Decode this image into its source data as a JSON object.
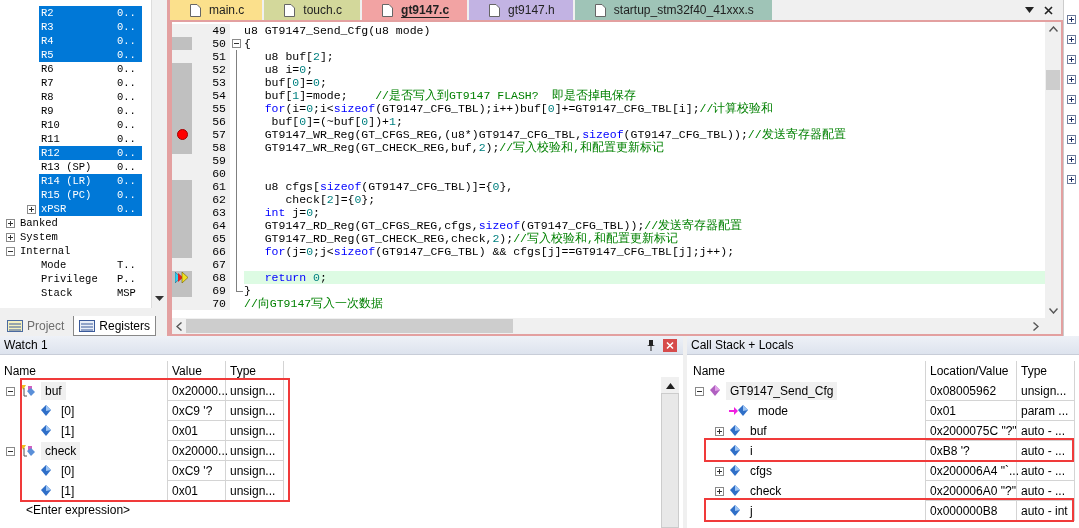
{
  "registers": {
    "rows": [
      {
        "name": "R2",
        "value": "0..",
        "selected": true
      },
      {
        "name": "R3",
        "value": "0..",
        "selected": true
      },
      {
        "name": "R4",
        "value": "0..",
        "selected": true
      },
      {
        "name": "R5",
        "value": "0..",
        "selected": true
      },
      {
        "name": "R6",
        "value": "0..",
        "selected": false
      },
      {
        "name": "R7",
        "value": "0..",
        "selected": false
      },
      {
        "name": "R8",
        "value": "0..",
        "selected": false
      },
      {
        "name": "R9",
        "value": "0..",
        "selected": false
      },
      {
        "name": "R10",
        "value": "0..",
        "selected": false
      },
      {
        "name": "R11",
        "value": "0..",
        "selected": false
      },
      {
        "name": "R12",
        "value": "0..",
        "selected": true
      },
      {
        "name": "R13 (SP)",
        "value": "0..",
        "selected": false
      },
      {
        "name": "R14 (LR)",
        "value": "0..",
        "selected": true
      },
      {
        "name": "R15 (PC)",
        "value": "0..",
        "selected": true
      },
      {
        "name": "xPSR",
        "value": "0..",
        "selected": true,
        "expanded": false
      }
    ],
    "groups": [
      {
        "name": "Banked",
        "selected": false,
        "expanded": false
      },
      {
        "name": "System",
        "selected": false,
        "expanded": false
      },
      {
        "name": "Internal",
        "selected": false,
        "expanded": true,
        "children": [
          {
            "name": "Mode",
            "value": "T..",
            "selected": false
          },
          {
            "name": "Privilege",
            "value": "P..",
            "selected": false
          },
          {
            "name": "Stack",
            "value": "MSP",
            "selected": false
          }
        ]
      }
    ]
  },
  "panel_tabs": [
    {
      "label": "Project",
      "selected": false
    },
    {
      "label": "Registers",
      "selected": true
    }
  ],
  "editor": {
    "tabs": [
      {
        "label": "main.c",
        "selected": false,
        "color": "#fbe08c"
      },
      {
        "label": "touch.c",
        "selected": false,
        "color": "#d3d89b"
      },
      {
        "label": "gt9147.c",
        "selected": true,
        "color": "#f2a3a3"
      },
      {
        "label": "gt9147.h",
        "selected": false,
        "color": "#c2b3e3"
      },
      {
        "label": "startup_stm32f40_41xxx.s",
        "selected": false,
        "color": "#9fc4b7"
      }
    ],
    "lines": [
      {
        "number": "49",
        "executable": false,
        "segments": [
          {
            "text": "u8 GT9147_Send_Cfg(u8 mode)",
            "kind": "plain"
          }
        ]
      },
      {
        "number": "50",
        "executable": true,
        "expanded": true,
        "segments": [
          {
            "text": "{",
            "kind": "plain"
          }
        ]
      },
      {
        "number": "51",
        "executable": false,
        "in_block": true,
        "segments": [
          {
            "text": "u8 buf[",
            "kind": "plain"
          },
          {
            "text": "2",
            "kind": "number"
          },
          {
            "text": "];",
            "kind": "plain"
          }
        ]
      },
      {
        "number": "52",
        "executable": true,
        "in_block": true,
        "segments": [
          {
            "text": "u8 i=",
            "kind": "plain"
          },
          {
            "text": "0",
            "kind": "number"
          },
          {
            "text": ";",
            "kind": "plain"
          }
        ]
      },
      {
        "number": "53",
        "executable": true,
        "in_block": true,
        "segments": [
          {
            "text": "buf[",
            "kind": "plain"
          },
          {
            "text": "0",
            "kind": "number"
          },
          {
            "text": "]=",
            "kind": "plain"
          },
          {
            "text": "0",
            "kind": "number"
          },
          {
            "text": ";",
            "kind": "plain"
          }
        ]
      },
      {
        "number": "54",
        "executable": true,
        "in_block": true,
        "segments": [
          {
            "text": "buf[",
            "kind": "plain"
          },
          {
            "text": "1",
            "kind": "number"
          },
          {
            "text": "]=mode;    ",
            "kind": "plain"
          },
          {
            "text": "//是否写入到GT9147 FLASH?  即是否掉电保存",
            "kind": "comment"
          }
        ]
      },
      {
        "number": "55",
        "executable": true,
        "in_block": true,
        "segments": [
          {
            "text": "for",
            "kind": "keyword"
          },
          {
            "text": "(i=",
            "kind": "plain"
          },
          {
            "text": "0",
            "kind": "number"
          },
          {
            "text": ";i<",
            "kind": "plain"
          },
          {
            "text": "sizeof",
            "kind": "keyword"
          },
          {
            "text": "(GT9147_CFG_TBL);i++)buf[",
            "kind": "plain"
          },
          {
            "text": "0",
            "kind": "number"
          },
          {
            "text": "]+=GT9147_CFG_TBL[i];",
            "kind": "plain"
          },
          {
            "text": "//计算校验和",
            "kind": "comment"
          }
        ]
      },
      {
        "number": "56",
        "executable": true,
        "in_block": true,
        "segments": [
          {
            "text": " buf[",
            "kind": "plain"
          },
          {
            "text": "0",
            "kind": "number"
          },
          {
            "text": "]=(~buf[",
            "kind": "plain"
          },
          {
            "text": "0",
            "kind": "number"
          },
          {
            "text": "])+",
            "kind": "plain"
          },
          {
            "text": "1",
            "kind": "number"
          },
          {
            "text": ";",
            "kind": "plain"
          }
        ]
      },
      {
        "number": "57",
        "executable": true,
        "in_block": true,
        "breakpoint": true,
        "segments": [
          {
            "text": "GT9147_WR_Reg(GT_CFGS_REG,(u8*)GT9147_CFG_TBL,",
            "kind": "plain"
          },
          {
            "text": "sizeof",
            "kind": "keyword"
          },
          {
            "text": "(GT9147_CFG_TBL));",
            "kind": "plain"
          },
          {
            "text": "//发送寄存器配置",
            "kind": "comment"
          }
        ]
      },
      {
        "number": "58",
        "executable": true,
        "in_block": true,
        "segments": [
          {
            "text": "GT9147_WR_Reg(GT_CHECK_REG,buf,",
            "kind": "plain"
          },
          {
            "text": "2",
            "kind": "number"
          },
          {
            "text": ");",
            "kind": "plain"
          },
          {
            "text": "//写入校验和,和配置更新标记",
            "kind": "comment"
          }
        ]
      },
      {
        "number": "59",
        "executable": false,
        "in_block": true
      },
      {
        "number": "60",
        "executable": false,
        "in_block": true
      },
      {
        "number": "61",
        "executable": true,
        "in_block": true,
        "segments": [
          {
            "text": "u8 cfgs[",
            "kind": "plain"
          },
          {
            "text": "sizeof",
            "kind": "keyword"
          },
          {
            "text": "(GT9147_CFG_TBL)]={",
            "kind": "plain"
          },
          {
            "text": "0",
            "kind": "number"
          },
          {
            "text": "},",
            "kind": "plain"
          }
        ]
      },
      {
        "number": "62",
        "executable": true,
        "in_block": true,
        "segments": [
          {
            "text": "   check[",
            "kind": "plain"
          },
          {
            "text": "2",
            "kind": "number"
          },
          {
            "text": "]={",
            "kind": "plain"
          },
          {
            "text": "0",
            "kind": "number"
          },
          {
            "text": "};",
            "kind": "plain"
          }
        ]
      },
      {
        "number": "63",
        "executable": true,
        "in_block": true,
        "segments": [
          {
            "text": "int",
            "kind": "keyword"
          },
          {
            "text": " j=",
            "kind": "plain"
          },
          {
            "text": "0",
            "kind": "number"
          },
          {
            "text": ";",
            "kind": "plain"
          }
        ]
      },
      {
        "number": "64",
        "executable": true,
        "in_block": true,
        "segments": [
          {
            "text": "GT9147_RD_Reg(GT_CFGS_REG,cfgs,",
            "kind": "plain"
          },
          {
            "text": "sizeof",
            "kind": "keyword"
          },
          {
            "text": "(GT9147_CFG_TBL));",
            "kind": "plain"
          },
          {
            "text": "//发送寄存器配置",
            "kind": "comment"
          }
        ]
      },
      {
        "number": "65",
        "executable": true,
        "in_block": true,
        "segments": [
          {
            "text": "GT9147_RD_Reg(GT_CHECK_REG,check,",
            "kind": "plain"
          },
          {
            "text": "2",
            "kind": "number"
          },
          {
            "text": ");",
            "kind": "plain"
          },
          {
            "text": "//写入校验和,和配置更新标记",
            "kind": "comment"
          }
        ]
      },
      {
        "number": "66",
        "executable": true,
        "in_block": true,
        "segments": [
          {
            "text": "for",
            "kind": "keyword"
          },
          {
            "text": "(j=",
            "kind": "plain"
          },
          {
            "text": "0",
            "kind": "number"
          },
          {
            "text": ";j<",
            "kind": "plain"
          },
          {
            "text": "sizeof",
            "kind": "keyword"
          },
          {
            "text": "(GT9147_CFG_TBL) && cfgs[j]==GT9147_CFG_TBL[j];j++);",
            "kind": "plain"
          }
        ]
      },
      {
        "number": "67",
        "executable": false,
        "in_block": true
      },
      {
        "number": "68",
        "executable": true,
        "in_block": true,
        "current": true,
        "segments": [
          {
            "text": "return ",
            "kind": "keyword"
          },
          {
            "text": "0",
            "kind": "number"
          },
          {
            "text": ";",
            "kind": "plain"
          }
        ]
      },
      {
        "number": "69",
        "executable": true,
        "block_end": true,
        "segments": [
          {
            "text": "}",
            "kind": "plain"
          }
        ]
      },
      {
        "number": "70",
        "executable": false,
        "segments": [
          {
            "text": "//向GT9147写入一次数据",
            "kind": "comment"
          }
        ]
      }
    ]
  },
  "watch": {
    "title": "Watch 1",
    "columns": [
      "Name",
      "Value",
      "Type"
    ],
    "rows": [
      {
        "name": "buf",
        "value": "0x20000...",
        "type": "unsign...",
        "kind": "struct",
        "expanded": true,
        "marked": true,
        "children": [
          {
            "name": "[0]",
            "value": "0xC9 '?",
            "type": "unsign...",
            "kind": "variable",
            "marked": true
          },
          {
            "name": "[1]",
            "value": "0x01",
            "type": "unsign...",
            "kind": "variable",
            "marked": true
          }
        ]
      },
      {
        "name": "check",
        "value": "0x20000...",
        "type": "unsign...",
        "kind": "struct",
        "expanded": true,
        "marked": true,
        "children": [
          {
            "name": "[0]",
            "value": "0xC9 '?",
            "type": "unsign...",
            "kind": "variable",
            "marked": true
          },
          {
            "name": "[1]",
            "value": "0x01",
            "type": "unsign...",
            "kind": "variable",
            "marked": true
          }
        ]
      }
    ],
    "new_expression": "<Enter expression>"
  },
  "call_stack": {
    "title": "Call Stack + Locals",
    "columns": [
      "Name",
      "Location/Value",
      "Type"
    ],
    "rows": [
      {
        "name": "GT9147_Send_Cfg",
        "value": "0x08005962",
        "type": "unsign...",
        "kind": "function",
        "expanded": true,
        "marked": false,
        "children": [
          {
            "name": "mode",
            "value": "0x01",
            "type": "param ...",
            "kind": "param",
            "marked": false
          },
          {
            "name": "buf",
            "value": "0x2000075C \"?\"",
            "type": "auto - ...",
            "kind": "variable",
            "expanded": false,
            "marked": false
          },
          {
            "name": "i",
            "value": "0xB8 '?",
            "type": "auto - ...",
            "kind": "variable",
            "marked": true
          },
          {
            "name": "cfgs",
            "value": "0x200006A4 \"`...",
            "type": "auto - ...",
            "kind": "variable",
            "expanded": false,
            "marked": false
          },
          {
            "name": "check",
            "value": "0x200006A0 \"?\"",
            "type": "auto - ...",
            "kind": "variable",
            "expanded": false,
            "marked": false
          },
          {
            "name": "j",
            "value": "0x000000B8",
            "type": "auto - int",
            "kind": "variable",
            "marked": true
          }
        ]
      }
    ]
  }
}
